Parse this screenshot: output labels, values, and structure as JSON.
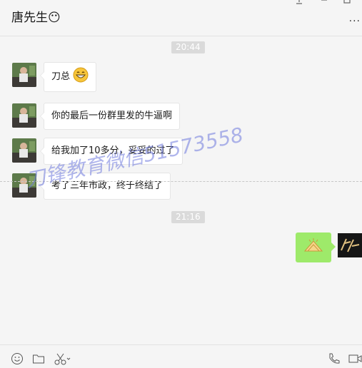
{
  "header": {
    "title": "唐先生😶",
    "pin_icon": "pin-icon",
    "more_label": "..."
  },
  "messages": [
    {
      "type": "time",
      "text": "20:44"
    },
    {
      "type": "received",
      "text": "刀总",
      "has_emoji": "grin-emoji"
    },
    {
      "type": "received",
      "text": "你的最后一份群里发的牛逼啊"
    },
    {
      "type": "received",
      "text": "给我加了10多分，妥妥的过了"
    },
    {
      "type": "received",
      "text": "考了三年市政，终于终结了"
    },
    {
      "type": "time",
      "text": "21:16"
    },
    {
      "type": "sent",
      "content": "clap-sticker"
    }
  ],
  "watermark": "刀锋教育微信51573558",
  "toolbar": {
    "icons": [
      "emoji-icon",
      "folder-icon",
      "scissors-icon",
      "phone-icon",
      "video-icon"
    ]
  },
  "colors": {
    "background": "#f5f5f5",
    "sent_bubble": "#9eea6a",
    "received_bubble": "#ffffff",
    "time_badge": "#dadada",
    "watermark": "#6e78dc"
  }
}
